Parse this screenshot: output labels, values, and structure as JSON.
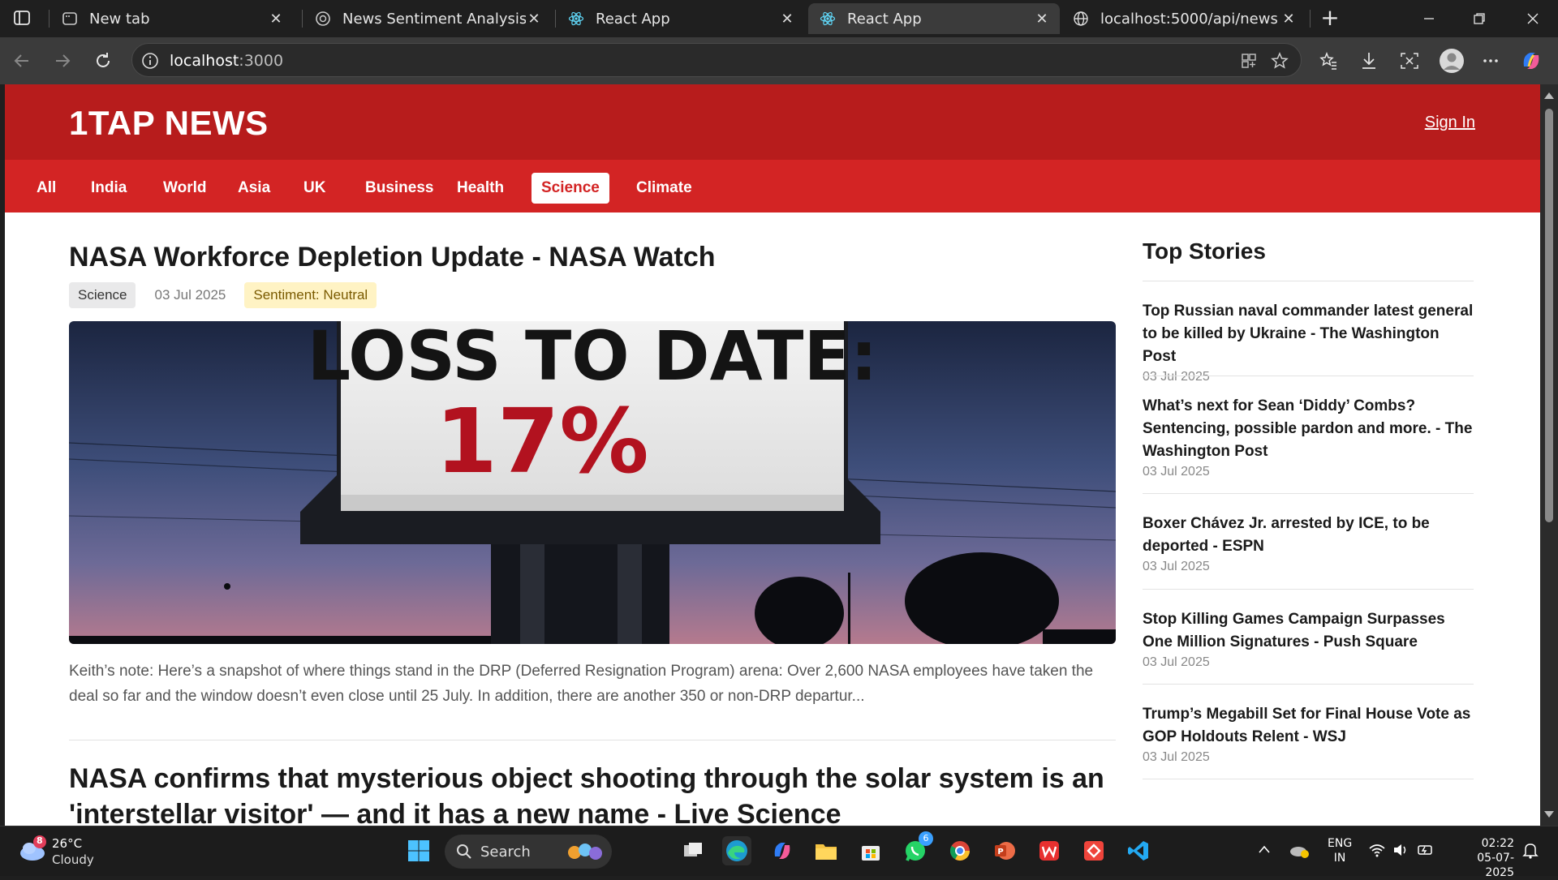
{
  "browser": {
    "tabs": [
      {
        "title": "New tab",
        "favicon": "newtab-icon"
      },
      {
        "title": "News Sentiment Analysis Page",
        "favicon": "chatgpt-icon"
      },
      {
        "title": "React App",
        "favicon": "react-icon"
      },
      {
        "title": "React App",
        "favicon": "react-icon"
      },
      {
        "title": "localhost:5000/api/news",
        "favicon": "globe-icon"
      }
    ],
    "active_tab_index": 3,
    "address": {
      "host": "localhost",
      "port": ":3000"
    }
  },
  "site": {
    "logo": "1TAP NEWS",
    "signin": "Sign In",
    "categories": [
      "All",
      "India",
      "World",
      "Asia",
      "UK",
      "Business",
      "Health",
      "Science",
      "Climate"
    ],
    "active_category": "Science",
    "colors": {
      "header": "#b71c1c",
      "nav": "#d32424"
    }
  },
  "article": {
    "title": "NASA Workforce Depletion Update - NASA Watch",
    "category": "Science",
    "date": "03 Jul 2025",
    "sentiment": "Sentiment: Neutral",
    "image_text": {
      "line1": "LOSS TO DATE:",
      "line2": "17%"
    },
    "excerpt": "Keith’s note: Here’s a snapshot of where things stand in the DRP (Deferred Resignation Program) arena: Over 2,600 NASA employees have taken the deal so far and the window doesn’t even close until 25 July. In addition, there are another 350 or non-DRP departur..."
  },
  "article2": {
    "title": "NASA confirms that mysterious object shooting through the solar system is an 'interstellar visitor' — and it has a new name - Live Science"
  },
  "top_stories": {
    "heading": "Top Stories",
    "items": [
      {
        "title": "Top Russian naval commander latest general to be killed by Ukraine - The Washington Post",
        "date": "03 Jul 2025"
      },
      {
        "title": "What’s next for Sean ‘Diddy’ Combs? Sentencing, possible pardon and more. - The Washington Post",
        "date": "03 Jul 2025"
      },
      {
        "title": "Boxer Chávez Jr. arrested by ICE, to be deported - ESPN",
        "date": "03 Jul 2025"
      },
      {
        "title": "Stop Killing Games Campaign Surpasses One Million Signatures - Push Square",
        "date": "03 Jul 2025"
      },
      {
        "title": "Trump’s Megabill Set for Final House Vote as GOP Holdouts Relent - WSJ",
        "date": "03 Jul 2025"
      }
    ]
  },
  "taskbar": {
    "weather": {
      "temp": "26°C",
      "condition": "Cloudy",
      "badge": "8"
    },
    "search_label": "Search",
    "whatsapp_badge": "6",
    "lang": {
      "line1": "ENG",
      "line2": "IN"
    },
    "time": "02:22",
    "date": "05-07-2025"
  }
}
